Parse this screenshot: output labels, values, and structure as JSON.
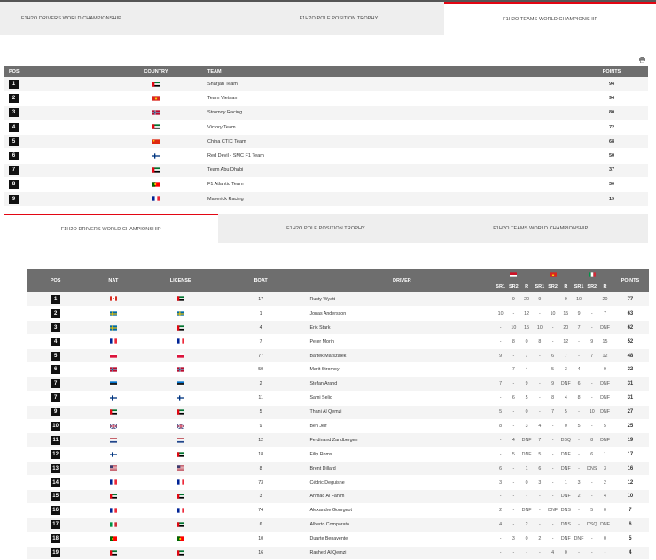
{
  "tabs_top": [
    "F1H2O DRIVERS WORLD CHAMPIONSHIP",
    "F1H2O POLE POSITION TROPHY",
    "F1H2O TEAMS WORLD CHAMPIONSHIP"
  ],
  "print_icon": "print-icon",
  "teams": {
    "headers": {
      "pos": "POS",
      "country": "COUNTRY",
      "team": "TEAM",
      "points": "POINTS"
    },
    "rows": [
      {
        "pos": "1",
        "flag": "uae",
        "team": "Sharjah Team",
        "points": "94"
      },
      {
        "pos": "2",
        "flag": "vietnam",
        "team": "Team Vietnam",
        "points": "94"
      },
      {
        "pos": "3",
        "flag": "norway",
        "team": "Stromoy Racing",
        "points": "80"
      },
      {
        "pos": "4",
        "flag": "uae",
        "team": "Victory Team",
        "points": "72"
      },
      {
        "pos": "5",
        "flag": "china",
        "team": "China CTIC Team",
        "points": "68"
      },
      {
        "pos": "6",
        "flag": "finland",
        "team": "Red Devil - SMC F1 Team",
        "points": "50"
      },
      {
        "pos": "7",
        "flag": "uae",
        "team": "Team Abu Dhabi",
        "points": "37"
      },
      {
        "pos": "8",
        "flag": "portugal",
        "team": "F1 Atlantic Team",
        "points": "30"
      },
      {
        "pos": "9",
        "flag": "france",
        "team": "Maverick Racing",
        "points": "19"
      }
    ]
  },
  "tabs_second": [
    "F1H2O DRIVERS WORLD CHAMPIONSHIP",
    "F1H2O POLE POSITION TROPHY",
    "F1H2O TEAMS WORLD CHAMPIONSHIP"
  ],
  "drivers": {
    "headers": {
      "pos": "POS",
      "nat": "NAT",
      "license": "LICENSE",
      "boat": "BOAT",
      "driver": "DRIVER",
      "points": "POINTS"
    },
    "race_flags": [
      "indonesia",
      "vietnam",
      "italy"
    ],
    "sub_headers": [
      "SR1",
      "SR2",
      "R",
      "SR1",
      "SR2",
      "R",
      "SR1",
      "SR2",
      "R"
    ],
    "rows": [
      {
        "pos": "1",
        "nat": "canada",
        "lic": "uae",
        "boat": "17",
        "name": "Rusty Wyatt",
        "r": [
          "-",
          "9",
          "20",
          "9",
          "-",
          "9",
          "10",
          "-",
          "20"
        ],
        "pts": "77"
      },
      {
        "pos": "2",
        "nat": "sweden",
        "lic": "sweden",
        "boat": "1",
        "name": "Jonas Andersson",
        "r": [
          "10",
          "-",
          "12",
          "-",
          "10",
          "15",
          "9",
          "-",
          "7"
        ],
        "pts": "63"
      },
      {
        "pos": "3",
        "nat": "sweden",
        "lic": "uae",
        "boat": "4",
        "name": "Erik Stark",
        "r": [
          "-",
          "10",
          "15",
          "10",
          "-",
          "20",
          "7",
          "-",
          "DNF"
        ],
        "pts": "62"
      },
      {
        "pos": "4",
        "nat": "france",
        "lic": "france",
        "boat": "7",
        "name": "Peter Morin",
        "r": [
          "-",
          "8",
          "0",
          "8",
          "-",
          "12",
          "-",
          "9",
          "15"
        ],
        "pts": "52"
      },
      {
        "pos": "5",
        "nat": "poland",
        "lic": "poland",
        "boat": "77",
        "name": "Bartek Marszalek",
        "r": [
          "9",
          "-",
          "7",
          "-",
          "6",
          "7",
          "-",
          "7",
          "12"
        ],
        "pts": "48"
      },
      {
        "pos": "6",
        "nat": "norway",
        "lic": "norway",
        "boat": "50",
        "name": "Marit Stromoy",
        "r": [
          "-",
          "7",
          "4",
          "-",
          "5",
          "3",
          "4",
          "-",
          "9"
        ],
        "pts": "32"
      },
      {
        "pos": "7",
        "nat": "estonia",
        "lic": "estonia",
        "boat": "2",
        "name": "Stefan Arand",
        "r": [
          "7",
          "-",
          "9",
          "-",
          "9",
          "DNF",
          "6",
          "-",
          "DNF"
        ],
        "pts": "31"
      },
      {
        "pos": "7",
        "nat": "finland",
        "lic": "finland",
        "boat": "11",
        "name": "Sami Selio",
        "r": [
          "-",
          "6",
          "5",
          "-",
          "8",
          "4",
          "8",
          "-",
          "DNF"
        ],
        "pts": "31"
      },
      {
        "pos": "9",
        "nat": "uae",
        "lic": "uae",
        "boat": "5",
        "name": "Thani Al Qemzi",
        "r": [
          "5",
          "-",
          "0",
          "-",
          "7",
          "5",
          "-",
          "10",
          "DNF"
        ],
        "pts": "27"
      },
      {
        "pos": "10",
        "nat": "uk",
        "lic": "uk",
        "boat": "9",
        "name": "Ben Jelf",
        "r": [
          "8",
          "-",
          "3",
          "4",
          "-",
          "0",
          "5",
          "-",
          "5"
        ],
        "pts": "25"
      },
      {
        "pos": "11",
        "nat": "netherlands",
        "lic": "netherlands",
        "boat": "12",
        "name": "Ferdinand Zandbergen",
        "r": [
          "-",
          "4",
          "DNF",
          "7",
          "-",
          "DSQ",
          "-",
          "8",
          "DNF"
        ],
        "pts": "19"
      },
      {
        "pos": "12",
        "nat": "finland",
        "lic": "uae",
        "boat": "18",
        "name": "Filip Roms",
        "r": [
          "-",
          "5",
          "DNF",
          "5",
          "-",
          "DNF",
          "-",
          "6",
          "1"
        ],
        "pts": "17"
      },
      {
        "pos": "13",
        "nat": "usa",
        "lic": "usa",
        "boat": "8",
        "name": "Brent Dillard",
        "r": [
          "6",
          "-",
          "1",
          "6",
          "-",
          "DNF",
          "-",
          "DNS",
          "3"
        ],
        "pts": "16"
      },
      {
        "pos": "14",
        "nat": "france",
        "lic": "france",
        "boat": "73",
        "name": "Cédric Deguisne",
        "r": [
          "3",
          "-",
          "0",
          "3",
          "-",
          "1",
          "3",
          "-",
          "2"
        ],
        "pts": "12"
      },
      {
        "pos": "15",
        "nat": "uae",
        "lic": "uae",
        "boat": "3",
        "name": "Ahmad Al Fahim",
        "r": [
          "-",
          "-",
          "-",
          "-",
          "-",
          "DNF",
          "2",
          "-",
          "4",
          "4"
        ],
        "pts": "10"
      },
      {
        "pos": "16",
        "nat": "france",
        "lic": "france",
        "boat": "74",
        "name": "Alexandre Gourgeot",
        "r": [
          "2",
          "-",
          "DNF",
          "-",
          "DNF",
          "DNS",
          "-",
          "5",
          "0"
        ],
        "pts": "7"
      },
      {
        "pos": "17",
        "nat": "italy",
        "lic": "uae",
        "boat": "6",
        "name": "Alberto Comparato",
        "r": [
          "4",
          "-",
          "2",
          "-",
          "-",
          "DNS",
          "-",
          "DSQ",
          "DNF"
        ],
        "pts": "6"
      },
      {
        "pos": "18",
        "nat": "portugal",
        "lic": "portugal",
        "boat": "10",
        "name": "Duarte Benavente",
        "r": [
          "-",
          "3",
          "0",
          "2",
          "-",
          "DNF",
          "DNF",
          "-",
          "0"
        ],
        "pts": "5"
      },
      {
        "pos": "19",
        "nat": "uae",
        "lic": "uae",
        "boat": "16",
        "name": "Rashed Al Qemzi",
        "r": [
          "-",
          "-",
          "-",
          "-",
          "4",
          "0",
          "-",
          "-",
          "-"
        ],
        "pts": "4"
      }
    ]
  }
}
